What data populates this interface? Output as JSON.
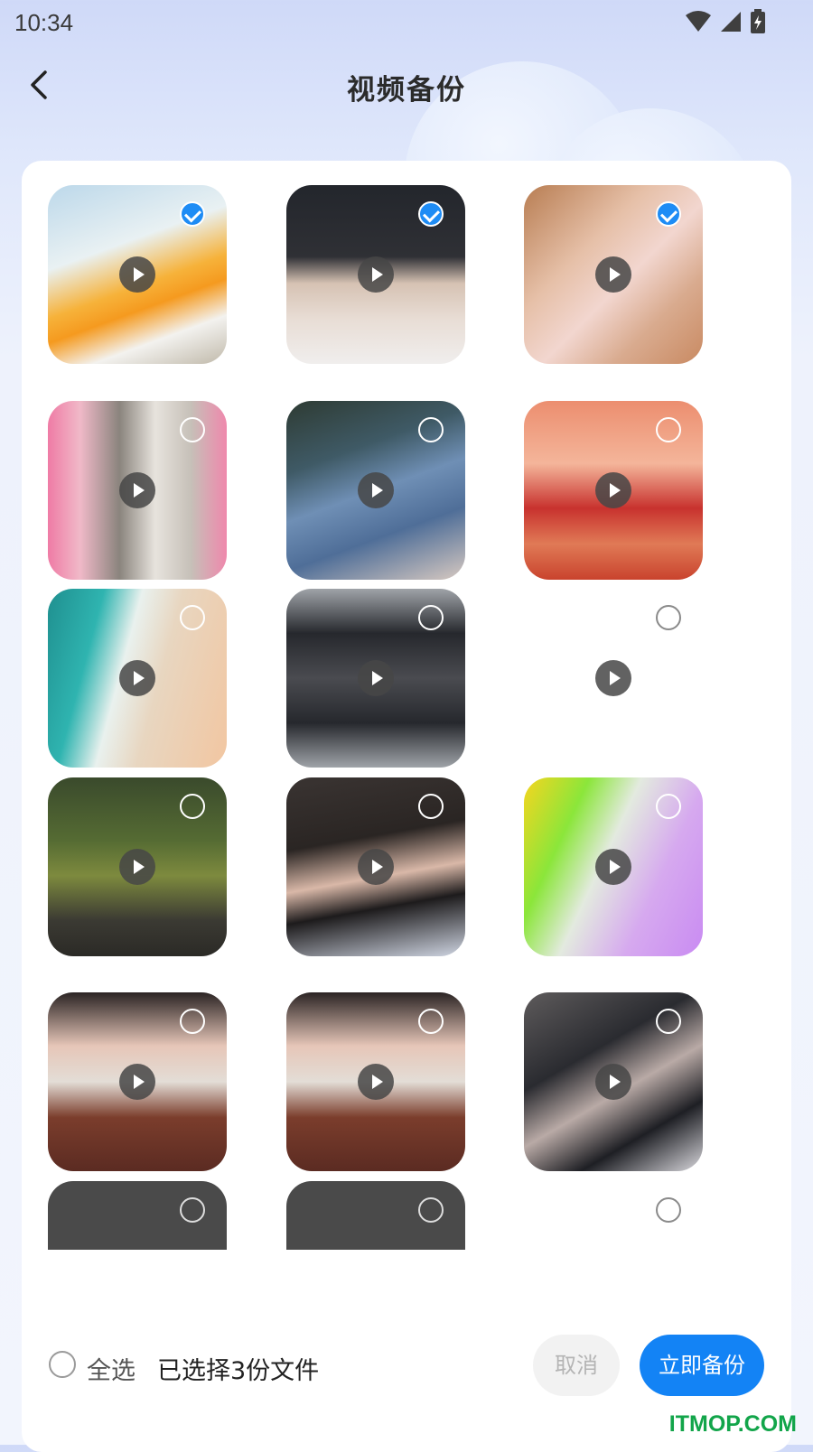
{
  "status_bar": {
    "time": "10:34",
    "icons": [
      "wifi-icon",
      "signal-icon",
      "battery-charging-icon"
    ]
  },
  "header": {
    "title": "视频备份",
    "back_icon": "chevron-left-icon"
  },
  "grid": {
    "items": [
      {
        "id": 1,
        "selected": true,
        "play_icon": "play-icon"
      },
      {
        "id": 2,
        "selected": true,
        "play_icon": "play-icon"
      },
      {
        "id": 3,
        "selected": true,
        "play_icon": "play-icon"
      },
      {
        "id": 4,
        "selected": false,
        "play_icon": "play-icon"
      },
      {
        "id": 5,
        "selected": false,
        "play_icon": "play-icon"
      },
      {
        "id": 6,
        "selected": false,
        "play_icon": "play-icon"
      },
      {
        "id": 7,
        "selected": false,
        "play_icon": "play-icon"
      },
      {
        "id": 8,
        "selected": false,
        "play_icon": "play-icon"
      },
      {
        "id": 9,
        "selected": false,
        "play_icon": "play-icon"
      },
      {
        "id": 10,
        "selected": false,
        "play_icon": "play-icon"
      },
      {
        "id": 11,
        "selected": false,
        "play_icon": "play-icon"
      },
      {
        "id": 12,
        "selected": false,
        "play_icon": "play-icon"
      },
      {
        "id": 13,
        "selected": false,
        "play_icon": "play-icon"
      },
      {
        "id": 14,
        "selected": false,
        "play_icon": "play-icon"
      },
      {
        "id": 15,
        "selected": false,
        "play_icon": "play-icon"
      },
      {
        "id": 16,
        "selected": false
      },
      {
        "id": 17,
        "selected": false
      },
      {
        "id": 18,
        "selected": false
      }
    ]
  },
  "footer": {
    "select_all_label": "全选",
    "selected_count_text": "已选择3份文件",
    "cancel_label": "取消",
    "backup_label": "立即备份"
  },
  "watermark": "ITMOP.COM",
  "colors": {
    "accent": "#1383f5",
    "check": "#1e8cf5",
    "watermark": "#12a54a"
  }
}
